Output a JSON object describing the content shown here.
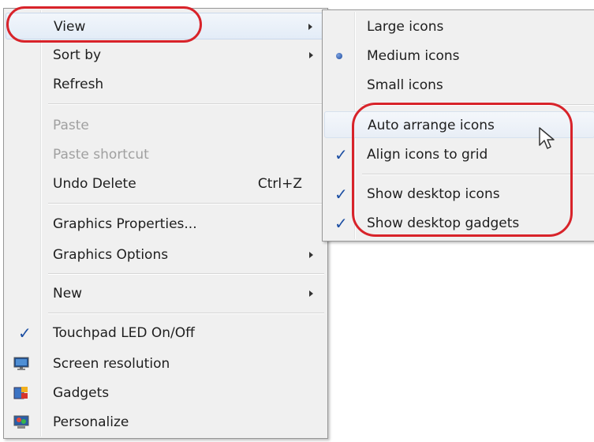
{
  "main_menu": {
    "view": {
      "label": "View"
    },
    "sort_by": {
      "label": "Sort by"
    },
    "refresh": {
      "label": "Refresh"
    },
    "paste": {
      "label": "Paste"
    },
    "paste_shortcut": {
      "label": "Paste shortcut"
    },
    "undo_delete": {
      "label": "Undo Delete",
      "shortcut": "Ctrl+Z"
    },
    "graphics_properties": {
      "label": "Graphics Properties..."
    },
    "graphics_options": {
      "label": "Graphics Options"
    },
    "new": {
      "label": "New"
    },
    "touchpad_led": {
      "label": "Touchpad LED On/Off",
      "checked": true
    },
    "screen_resolution": {
      "label": "Screen resolution",
      "icon": "monitor-icon"
    },
    "gadgets": {
      "label": "Gadgets",
      "icon": "gadgets-icon"
    },
    "personalize": {
      "label": "Personalize",
      "icon": "personalize-icon"
    }
  },
  "view_submenu": {
    "large_icons": {
      "label": "Large icons"
    },
    "medium_icons": {
      "label": "Medium icons",
      "selected": true
    },
    "small_icons": {
      "label": "Small icons"
    },
    "auto_arrange": {
      "label": "Auto arrange icons"
    },
    "align_to_grid": {
      "label": "Align icons to grid",
      "checked": true
    },
    "show_desktop_icons": {
      "label": "Show desktop icons",
      "checked": true
    },
    "show_desktop_gadgets": {
      "label": "Show desktop gadgets",
      "checked": true
    }
  },
  "colors": {
    "annotation_red": "#d8232a",
    "check_blue": "#1d4fa3",
    "menu_background": "#f0f0f0",
    "disabled_text": "#a0a0a0"
  }
}
